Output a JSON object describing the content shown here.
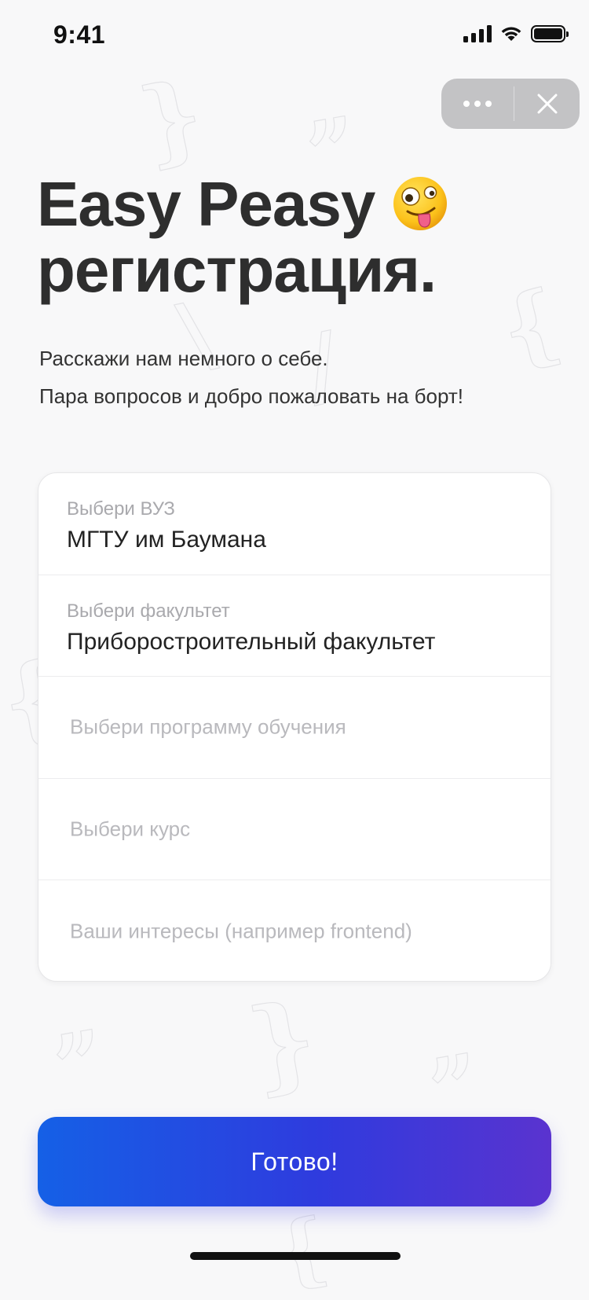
{
  "status_bar": {
    "time": "9:41"
  },
  "capsule": {
    "more_icon": "more-dots-icon",
    "close_icon": "close-icon"
  },
  "header": {
    "title_line1": "Easy Peasy",
    "title_emoji": "zany-face-emoji",
    "title_line2": "регистрация.",
    "subtitle_line1": "Расскажи нам немного о себе.",
    "subtitle_line2": "Пара вопросов и добро пожаловать на борт!"
  },
  "form": {
    "university": {
      "label": "Выбери ВУЗ",
      "value": "МГТУ им Баумана"
    },
    "faculty": {
      "label": "Выбери факультет",
      "value": "Приборостроительный факультет"
    },
    "program": {
      "placeholder": "Выбери программу обучения"
    },
    "course": {
      "placeholder": "Выбери курс"
    },
    "interests": {
      "placeholder": "Ваши интересы (например frontend)"
    }
  },
  "submit": {
    "label": "Готово!"
  },
  "colors": {
    "background": "#f8f8f9",
    "button_gradient_start": "#1560e6",
    "button_gradient_end": "#5a33cf",
    "capsule": "#c3c3c5"
  }
}
